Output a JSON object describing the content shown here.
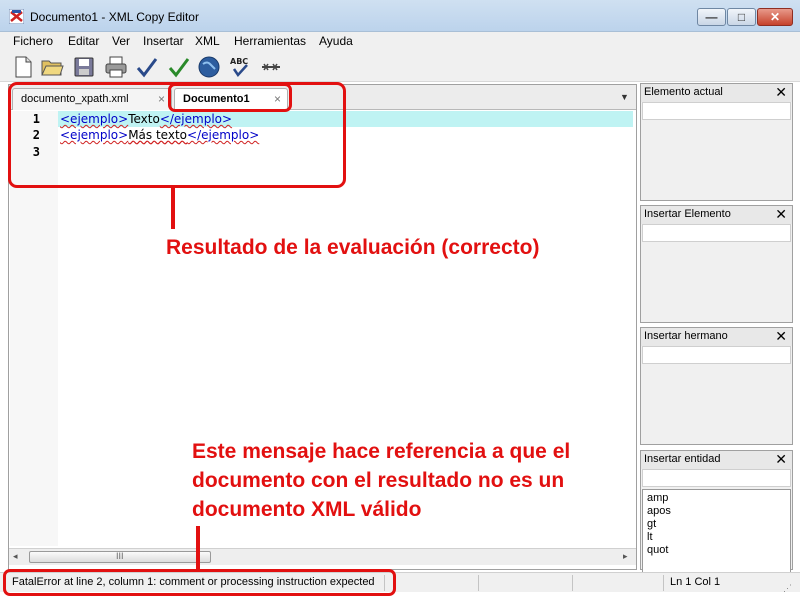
{
  "window": {
    "title": "Documento1 - XML Copy Editor",
    "minimize_glyph": "—",
    "maximize_glyph": "□",
    "close_glyph": "✕"
  },
  "menu": [
    "Fichero",
    "Editar",
    "Ver",
    "Insertar",
    "XML",
    "Herramientas",
    "Ayuda"
  ],
  "toolbar": {
    "icons": [
      "new-document-icon",
      "open-folder-icon",
      "save-icon",
      "print-icon",
      "check-wellformed-icon",
      "validate-icon",
      "browser-icon",
      "spellcheck-icon",
      "xpath-icon"
    ]
  },
  "tabs": [
    {
      "label": "documento_xpath.xml",
      "close": "×",
      "active": false
    },
    {
      "label": "Documento1",
      "close": "×",
      "active": true
    }
  ],
  "tab_menu_glyph": "▼",
  "editor": {
    "line_numbers": [
      "1",
      "2",
      "3"
    ],
    "lines": [
      {
        "open_tag": "<ejemplo>",
        "text": "Texto",
        "close_tag": "</ejemplo>"
      },
      {
        "open_tag": "<ejemplo>",
        "text": "Más texto",
        "close_tag": "</ejemplo>"
      }
    ],
    "scroll_grip": "III",
    "scroll_left": "◂",
    "scroll_right": "▸"
  },
  "panels": [
    {
      "title": "Elemento actual",
      "close": "✕"
    },
    {
      "title": "Insertar Elemento",
      "close": "✕"
    },
    {
      "title": "Insertar hermano",
      "close": "✕"
    },
    {
      "title": "Insertar entidad",
      "close": "✕",
      "entities": [
        "amp",
        "apos",
        "gt",
        "lt",
        "quot"
      ]
    }
  ],
  "status": {
    "message": "FatalError at line 2, column 1: comment or processing instruction expected",
    "position": "Ln 1 Col 1",
    "grip": "⋰"
  },
  "annotations": {
    "result_label": "Resultado de la evaluación (correcto)",
    "error_note_lines": [
      "Este mensaje hace referencia a que el",
      "documento con el resultado no es un",
      "documento XML válido"
    ]
  },
  "colors": {
    "annotation": "#e21010",
    "tag": "#0000c8",
    "current_line": "#bff3f3"
  }
}
